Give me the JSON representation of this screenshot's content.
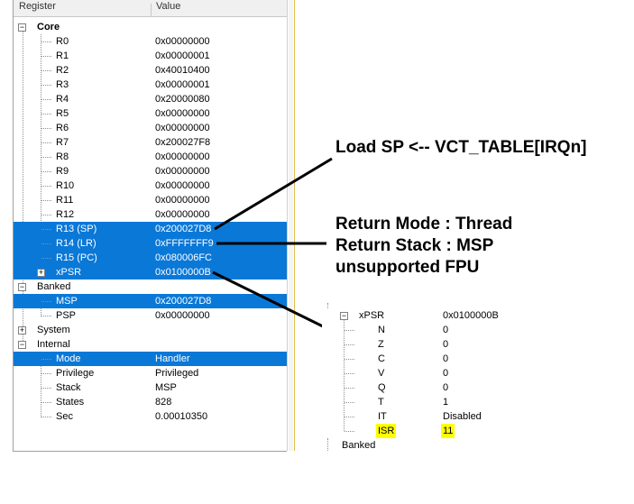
{
  "header": {
    "col_register": "Register",
    "col_value": "Value"
  },
  "tree": {
    "core_label": "Core",
    "core_regs": [
      {
        "name": "R0",
        "value": "0x00000000"
      },
      {
        "name": "R1",
        "value": "0x00000001"
      },
      {
        "name": "R2",
        "value": "0x40010400"
      },
      {
        "name": "R3",
        "value": "0x00000001"
      },
      {
        "name": "R4",
        "value": "0x20000080"
      },
      {
        "name": "R5",
        "value": "0x00000000"
      },
      {
        "name": "R6",
        "value": "0x00000000"
      },
      {
        "name": "R7",
        "value": "0x200027F8"
      },
      {
        "name": "R8",
        "value": "0x00000000"
      },
      {
        "name": "R9",
        "value": "0x00000000"
      },
      {
        "name": "R10",
        "value": "0x00000000"
      },
      {
        "name": "R11",
        "value": "0x00000000"
      },
      {
        "name": "R12",
        "value": "0x00000000"
      },
      {
        "name": "R13 (SP)",
        "value": "0x200027D8"
      },
      {
        "name": "R14 (LR)",
        "value": "0xFFFFFFF9"
      },
      {
        "name": "R15 (PC)",
        "value": "0x080006FC"
      },
      {
        "name": "xPSR",
        "value": "0x0100000B"
      }
    ],
    "banked_label": "Banked",
    "banked_regs": [
      {
        "name": "MSP",
        "value": "0x200027D8"
      },
      {
        "name": "PSP",
        "value": "0x00000000"
      }
    ],
    "system_label": "System",
    "internal_label": "Internal",
    "internal_regs": [
      {
        "name": "Mode",
        "value": "Handler"
      },
      {
        "name": "Privilege",
        "value": "Privileged"
      },
      {
        "name": "Stack",
        "value": "MSP"
      },
      {
        "name": "States",
        "value": "828"
      },
      {
        "name": "Sec",
        "value": "0.00010350"
      }
    ]
  },
  "annotations": {
    "load_sp": "Load SP <-- VCT_TABLE[IRQn]",
    "return_mode": "Return Mode : Thread",
    "return_stack": "Return Stack : MSP",
    "fpu": "unsupported FPU"
  },
  "inset": {
    "xpsr_name": "xPSR",
    "xpsr_value": "0x0100000B",
    "fields": [
      {
        "name": "N",
        "value": "0"
      },
      {
        "name": "Z",
        "value": "0"
      },
      {
        "name": "C",
        "value": "0"
      },
      {
        "name": "V",
        "value": "0"
      },
      {
        "name": "Q",
        "value": "0"
      },
      {
        "name": "T",
        "value": "1"
      },
      {
        "name": "IT",
        "value": "Disabled"
      },
      {
        "name": "ISR",
        "value": "11"
      }
    ],
    "banked_label": "Banked"
  },
  "colors": {
    "selection": "#0a78d7",
    "highlight": "#ffff00"
  }
}
